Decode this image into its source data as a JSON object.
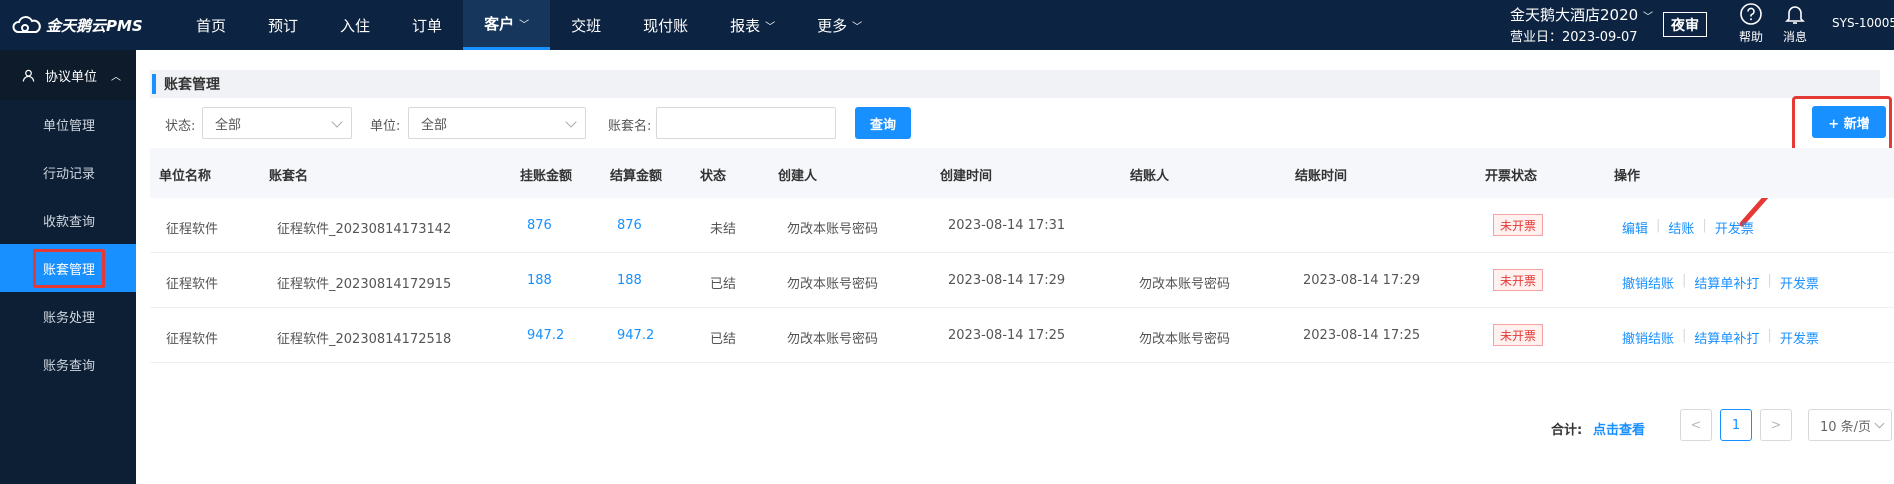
{
  "app": {
    "logo_text": "金天鹅云PMS"
  },
  "nav": [
    {
      "label": "首页"
    },
    {
      "label": "预订"
    },
    {
      "label": "入住"
    },
    {
      "label": "订单"
    },
    {
      "label": "客户",
      "active": true
    },
    {
      "label": "交班"
    },
    {
      "label": "现付账"
    },
    {
      "label": "报表"
    },
    {
      "label": "更多"
    }
  ],
  "header": {
    "hotel_name": "金天鹅大酒店2020",
    "business_date": "营业日：2023-09-07",
    "night_audit": "夜审",
    "help": "帮助",
    "messages": "消息",
    "user": "SYS-10005"
  },
  "sidebar": {
    "section": "协议单位",
    "items": [
      {
        "label": "单位管理"
      },
      {
        "label": "行动记录"
      },
      {
        "label": "收款查询"
      },
      {
        "label": "账套管理",
        "active": true
      },
      {
        "label": "账务处理"
      },
      {
        "label": "账务查询"
      }
    ]
  },
  "page": {
    "title": "账套管理"
  },
  "filters": {
    "status_label": "状态:",
    "status_value": "全部",
    "unit_label": "单位:",
    "unit_value": "全部",
    "name_label": "账套名:",
    "name_value": "",
    "query_button": "查询",
    "add_button": "+ 新增"
  },
  "table": {
    "columns": [
      "单位名称",
      "账套名",
      "挂账金额",
      "结算金额",
      "状态",
      "创建人",
      "创建时间",
      "结账人",
      "结账时间",
      "开票状态",
      "操作"
    ],
    "rows": [
      {
        "unit": "征程软件",
        "name": "征程软件_20230814173142",
        "charged": "876",
        "settled": "876",
        "status": "未结",
        "creator": "勿改本账号密码",
        "created": "2023-08-14 17:31",
        "closer": "",
        "closed": "",
        "invoice": "未开票",
        "ops": [
          "编辑",
          "结账",
          "开发票"
        ]
      },
      {
        "unit": "征程软件",
        "name": "征程软件_20230814172915",
        "charged": "188",
        "settled": "188",
        "status": "已结",
        "creator": "勿改本账号密码",
        "created": "2023-08-14 17:29",
        "closer": "勿改本账号密码",
        "closed": "2023-08-14 17:29",
        "invoice": "未开票",
        "ops": [
          "撤销结账",
          "结算单补打",
          "开发票"
        ]
      },
      {
        "unit": "征程软件",
        "name": "征程软件_20230814172518",
        "charged": "947.2",
        "settled": "947.2",
        "status": "已结",
        "creator": "勿改本账号密码",
        "created": "2023-08-14 17:25",
        "closer": "勿改本账号密码",
        "closed": "2023-08-14 17:25",
        "invoice": "未开票",
        "ops": [
          "撤销结账",
          "结算单补打",
          "开发票"
        ]
      }
    ]
  },
  "footer": {
    "total_label": "合计:",
    "total_link": "点击查看",
    "prev": "<",
    "current_page": "1",
    "next": ">",
    "page_size": "10 条/页"
  }
}
